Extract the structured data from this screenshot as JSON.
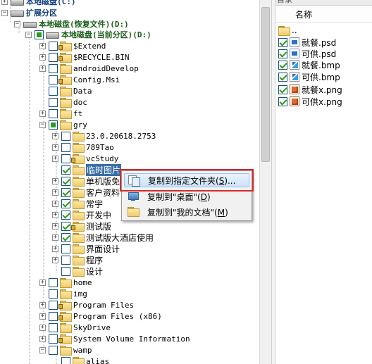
{
  "tree": {
    "rows": [
      {
        "label": "本地磁盘(C:)",
        "type": "drive"
      },
      {
        "label": "扩展分区",
        "type": "drive"
      },
      {
        "label": "本地磁盘(恢复文件)(D:)",
        "type": "drive"
      },
      {
        "label": "本地磁盘(当前分区)(D:)",
        "type": "drive"
      },
      {
        "label": "$Extend"
      },
      {
        "label": "$RECYCLE.BIN"
      },
      {
        "label": "androidDevelop"
      },
      {
        "label": "Config.Msi"
      },
      {
        "label": "Data"
      },
      {
        "label": "doc"
      },
      {
        "label": "ft"
      },
      {
        "label": "gry"
      },
      {
        "label": "23.0.20618.2753"
      },
      {
        "label": "789Tao"
      },
      {
        "label": "vcStudy"
      },
      {
        "label": "临时图片"
      },
      {
        "label": "单机版免"
      },
      {
        "label": "客户资料"
      },
      {
        "label": "常宇"
      },
      {
        "label": "开发中"
      },
      {
        "label": "测试版"
      },
      {
        "label": "测试版大酒店使用"
      },
      {
        "label": "界面设计"
      },
      {
        "label": "程序"
      },
      {
        "label": "设计"
      },
      {
        "label": "home"
      },
      {
        "label": "img"
      },
      {
        "label": "Program Files"
      },
      {
        "label": "Program Files (x86)"
      },
      {
        "label": "SkyDrive"
      },
      {
        "label": "System Volume Information"
      },
      {
        "label": "wamp"
      },
      {
        "label": "alias"
      }
    ]
  },
  "file_list": {
    "tab_label": "目录",
    "column_header": "名称",
    "parent_label": "..",
    "files": [
      {
        "name": "就餐.psd",
        "kind": "psd"
      },
      {
        "name": "可供.psd",
        "kind": "psd"
      },
      {
        "name": "就餐.bmp",
        "kind": "bmp"
      },
      {
        "name": "可供.bmp",
        "kind": "bmp"
      },
      {
        "name": "就餐x.png",
        "kind": "png"
      },
      {
        "name": "可供x.png",
        "kind": "png"
      }
    ]
  },
  "context_menu": {
    "items": [
      {
        "label_prefix": "复制到指定文件夹(",
        "key": "S",
        "label_suffix": ")...",
        "icon": "copy-icon"
      },
      {
        "label_prefix": "复制到\"桌面\"(",
        "key": "D",
        "label_suffix": ")",
        "icon": "desktop-icon"
      },
      {
        "label_prefix": "复制到\"我的文档\"(",
        "key": "M",
        "label_suffix": ")",
        "icon": "folder-icon"
      }
    ]
  },
  "colors": {
    "selection": "#3a6ea5",
    "check": "#2a9a1a",
    "highlight_box": "#d42a2a"
  }
}
